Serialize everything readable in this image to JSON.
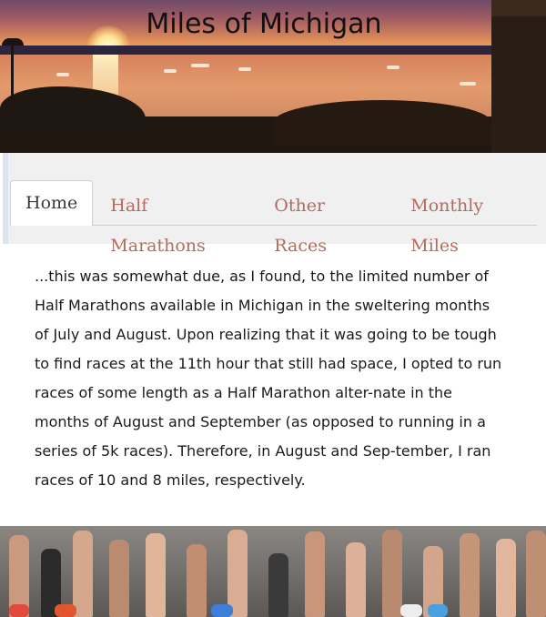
{
  "site": {
    "title": "Miles of Michigan"
  },
  "nav": {
    "tabs": [
      {
        "label": "Home",
        "active": true
      },
      {
        "label": "Half Marathons",
        "active": false
      },
      {
        "label": "Other Races",
        "active": false
      },
      {
        "label": "Monthly Miles",
        "active": false
      }
    ]
  },
  "content": {
    "paragraph": "...this was somewhat due, as I found, to the limited number of Half Marathons available in Michigan in the sweltering months of July and August. Upon realizing that it was going to be tough to find races at the 11th hour that still had space, I opted to run races of some length as a Half Marathon alter-nate in the months of August and September (as opposed to running in a series of 5k races). Therefore, in August and Sep-tember, I ran races of 10 and 8 miles, respectively."
  },
  "colors": {
    "tab_text": "#b36b5d",
    "active_tab_text": "#3a3a3a",
    "nav_background": "#f0f0f0"
  }
}
